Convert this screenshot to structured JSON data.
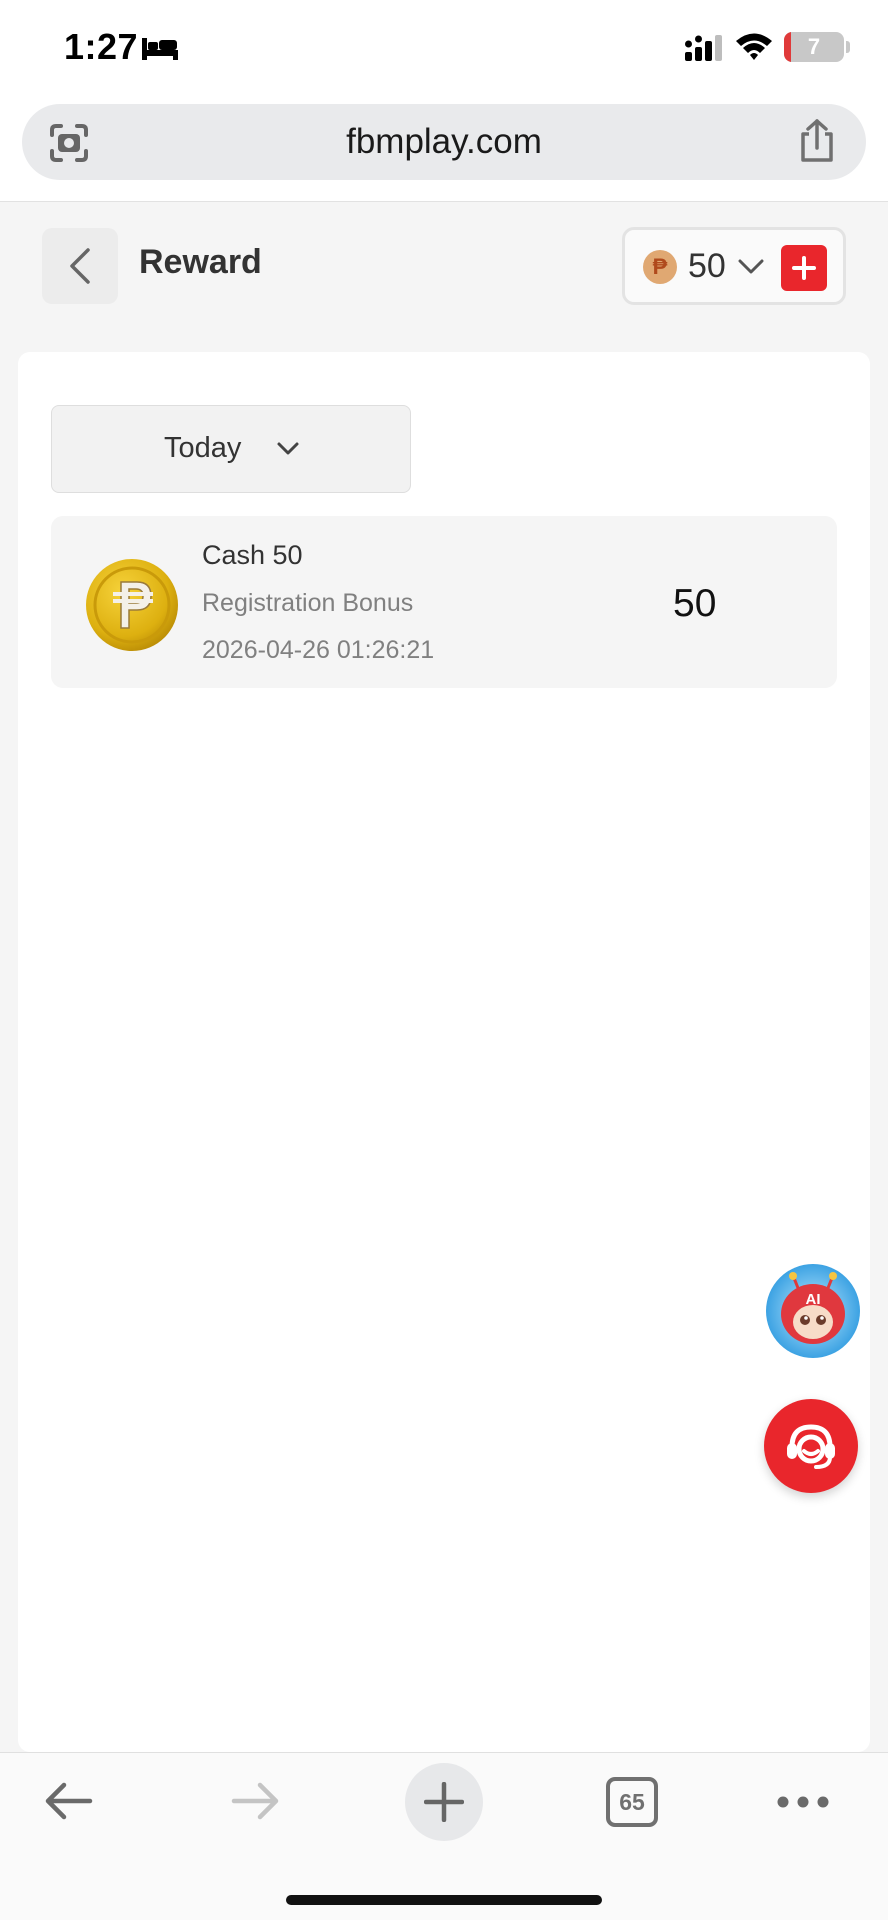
{
  "status_bar": {
    "time": "1:27",
    "battery_level": "7",
    "battery_fraction": 0.07,
    "icons": [
      "sleep-focus-icon",
      "cellular-signal-icon",
      "wifi-icon",
      "battery-icon"
    ]
  },
  "browser": {
    "url": "fbmplay.com",
    "icons": [
      "lens-icon",
      "share-icon"
    ]
  },
  "header": {
    "title": "Reward",
    "balance": "50",
    "currency_symbol": "₱",
    "icons": [
      "back-icon",
      "peso-icon",
      "chevron-down-icon",
      "plus-icon"
    ]
  },
  "filter": {
    "label": "Today"
  },
  "rewards": [
    {
      "title": "Cash 50",
      "subtitle": "Registration Bonus",
      "time": "2026-04-26 01:26:21",
      "value": "50",
      "icon": "peso-coin-icon"
    }
  ],
  "floating": {
    "ai_badge": "AI",
    "icons": [
      "ai-assistant-icon",
      "customer-support-icon"
    ]
  },
  "toolbar": {
    "tab_count": "65",
    "icons": [
      "back-arrow-icon",
      "forward-arrow-icon",
      "new-tab-icon",
      "tabs-icon",
      "more-icon"
    ]
  },
  "colors": {
    "accent_red": "#e9262c",
    "coin_gold": "#d9a80f",
    "page_bg": "#f5f5f5"
  }
}
